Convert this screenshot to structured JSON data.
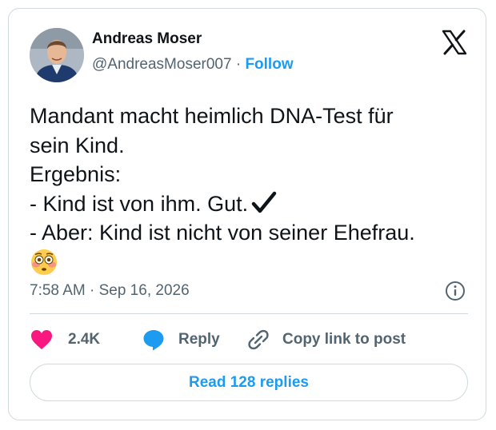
{
  "post": {
    "author_name": "Andreas Moser",
    "handle": "@AndreasMoser007",
    "separator": "·",
    "follow_label": "Follow",
    "text_lines": [
      "Mandant macht heimlich DNA-Test für",
      "sein Kind.",
      "Ergebnis:",
      "- Kind ist von ihm. Gut.",
      "- Aber: Kind ist nicht von seiner Ehefrau."
    ],
    "timestamp": "7:58 AM · Sep 16, 2026"
  },
  "actions": {
    "like_count": "2.4K",
    "reply_label": "Reply",
    "copy_link_label": "Copy link to post"
  },
  "footer": {
    "read_replies_label": "Read 128 replies"
  },
  "icons": {
    "logo": "x-logo-icon",
    "check": "check-mark-icon",
    "emoji": "flushed-face-emoji-icon",
    "info": "info-icon",
    "like": "heart-icon",
    "reply": "speech-bubble-icon",
    "link": "link-icon"
  },
  "colors": {
    "accent": "#1d9bf0",
    "like": "#f91880",
    "text": "#0f1419",
    "secondary": "#536471",
    "border": "#cfd9de"
  }
}
